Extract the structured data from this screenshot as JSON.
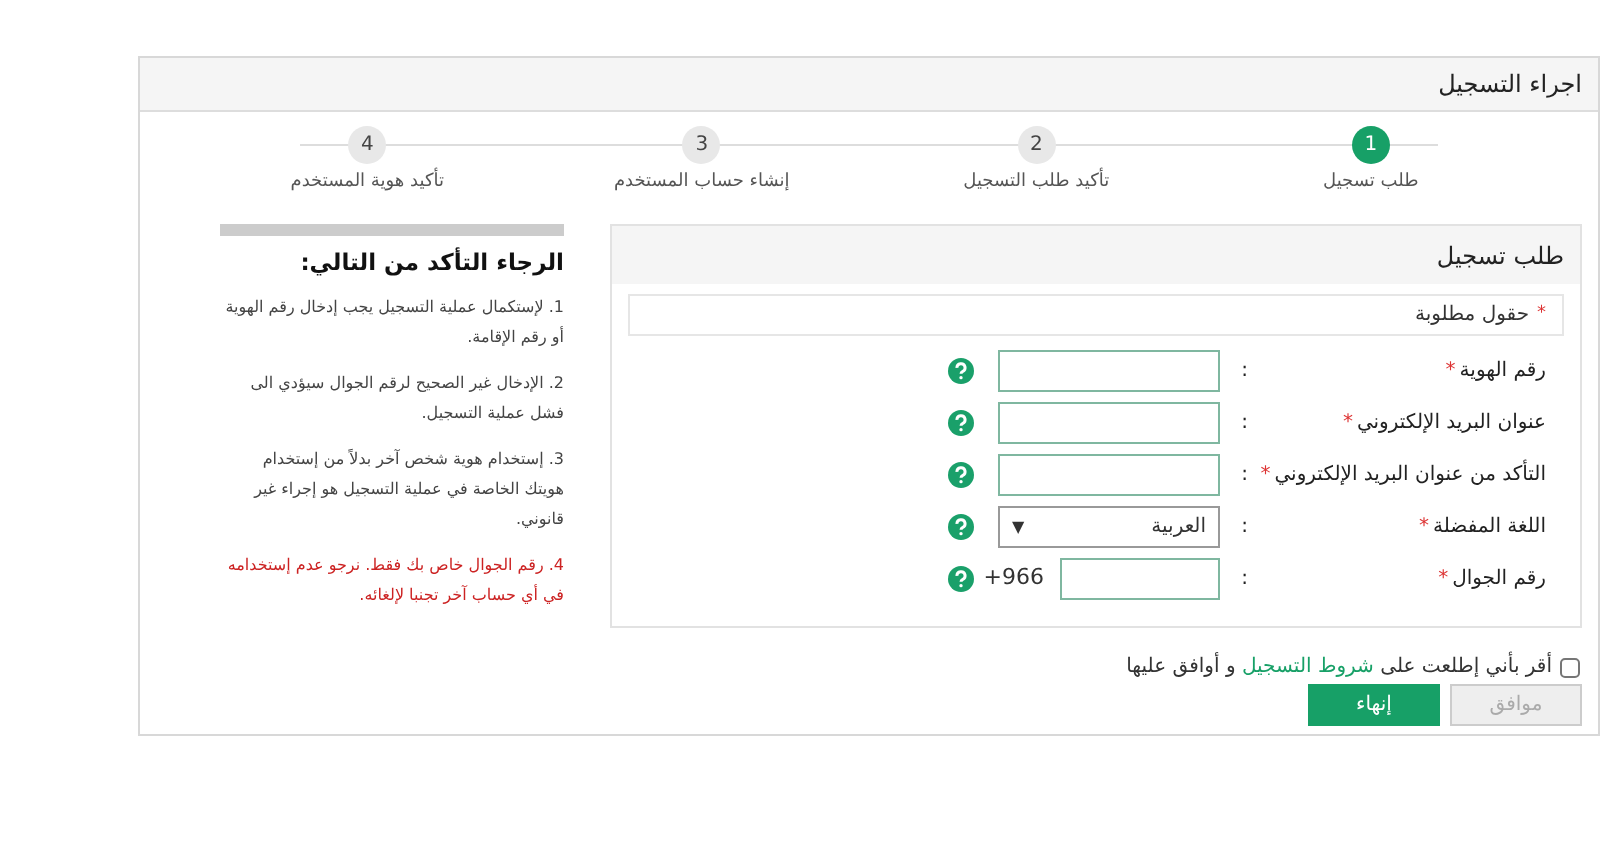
{
  "window": {
    "title": "اجراء التسجيل"
  },
  "steps": [
    {
      "number": "1",
      "label": "طلب تسجيل",
      "selected": true
    },
    {
      "number": "2",
      "label": "تأكيد طلب التسجيل",
      "selected": false
    },
    {
      "number": "3",
      "label": "إنشاء حساب المستخدم",
      "selected": false
    },
    {
      "number": "4",
      "label": "تأكيد هوية المستخدم",
      "selected": false
    }
  ],
  "form": {
    "title": "طلب تسجيل",
    "required_note": {
      "mark": "*",
      "text": "حقول مطلوبة"
    },
    "fields": [
      {
        "kind": "text",
        "label": "رقم الهوية",
        "required_mark": "*",
        "colon": ":"
      },
      {
        "kind": "text",
        "label": "عنوان البريد الإلكتروني",
        "required_mark": "*",
        "colon": ":"
      },
      {
        "kind": "text",
        "label": "التأكد من عنوان البريد الإلكتروني",
        "required_mark": "*",
        "colon": ":"
      },
      {
        "kind": "select",
        "label": "اللغة المفضلة",
        "required_mark": "*",
        "colon": ":",
        "value": "العربية",
        "caret": "▼"
      },
      {
        "kind": "phone",
        "label": "رقم الجوال",
        "required_mark": "*",
        "colon": ":",
        "prefix": "+966"
      }
    ],
    "agreement": {
      "checked": false,
      "before": "أقر بأني إطلعت على",
      "link": "شروط التسجيل",
      "after": "و أوافق عليها"
    },
    "buttons": [
      {
        "label": "موافق",
        "disabled": true
      },
      {
        "label": "إنهاء",
        "disabled": false
      }
    ]
  },
  "notes": {
    "title": "الرجاء التأكد من التالي:",
    "items": [
      {
        "text": "1. لإستكمال عملية التسجيل يجب إدخال رقم الهوية أو رقم الإقامة.",
        "color": "#444444"
      },
      {
        "text": "2. الإدخال غير الصحيح لرقم الجوال سيؤدي الى فشل عملية التسجيل.",
        "color": "#444444"
      },
      {
        "text": "3. إستخدام هوية شخص آخر بدلاً من إستخدام هويتك الخاصة في عملية التسجيل هو إجراء غير قانوني.",
        "color": "#444444"
      },
      {
        "text": "4. رقم الجوال خاص بك فقط. نرجو عدم إستخدامه في أي حساب آخر تجنبا لإلغائه.",
        "color": "#cc2222"
      }
    ]
  }
}
